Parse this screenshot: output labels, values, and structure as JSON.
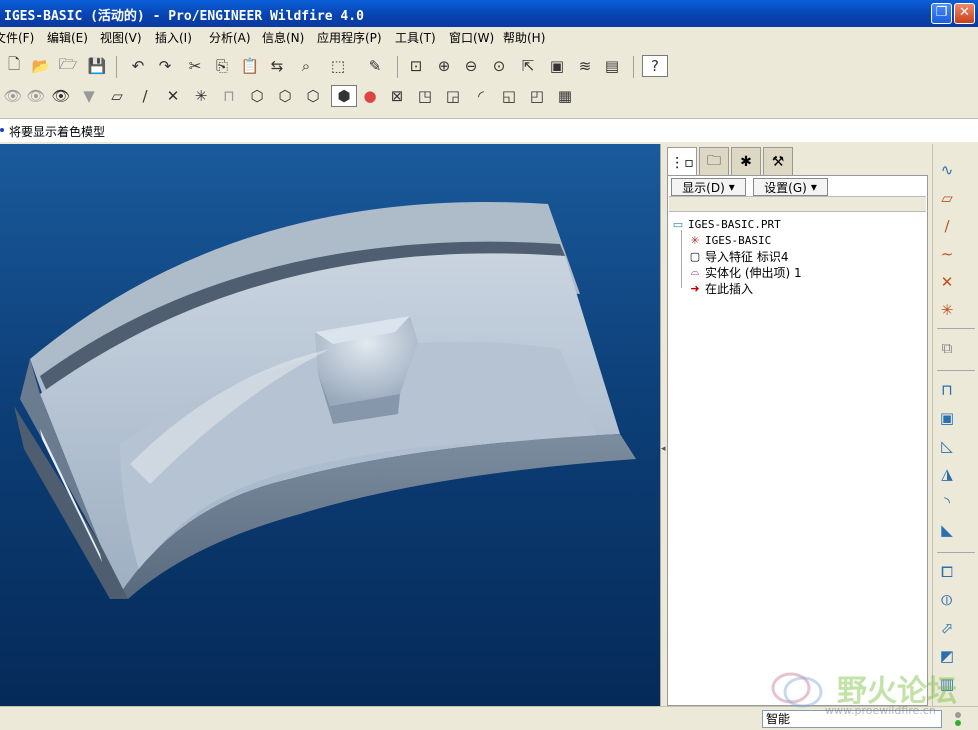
{
  "window": {
    "title": "IGES-BASIC (活动的) - Pro/ENGINEER Wildfire 4.0",
    "restore_glyph": "❐",
    "close_glyph": "✕"
  },
  "menu": [
    "文件(F)",
    "编辑(E)",
    "视图(V)",
    "插入(I)",
    "分析(A)",
    "信息(N)",
    "应用程序(P)",
    "工具(T)",
    "窗口(W)",
    "帮助(H)"
  ],
  "message_line": "将要显示着色模型",
  "navigator": {
    "tabs": [
      "model-tree",
      "folder-browser",
      "favorites",
      "connections"
    ],
    "show_label": "显示(D)",
    "settings_label": "设置(G)",
    "tree": [
      {
        "label": "IGES-BASIC.PRT",
        "icon": "part-icon"
      },
      {
        "label": "IGES-BASIC",
        "icon": "datum-csys-icon"
      },
      {
        "label": "导入特征 标识4",
        "icon": "import-feature-icon"
      },
      {
        "label": "实体化 (伸出项) 1",
        "icon": "solidify-icon"
      },
      {
        "label": "在此插入",
        "icon": "insert-here-arrow-icon"
      }
    ]
  },
  "status": {
    "filter_value": "智能"
  },
  "watermark": {
    "text": "野火论坛",
    "url": "www.proewildfire.cn"
  },
  "colors": {
    "title_blue": "#0a5fd8",
    "viewport_top": "#1a5a9c",
    "viewport_bottom": "#052a58",
    "model_surface": "#b8c6d6"
  }
}
